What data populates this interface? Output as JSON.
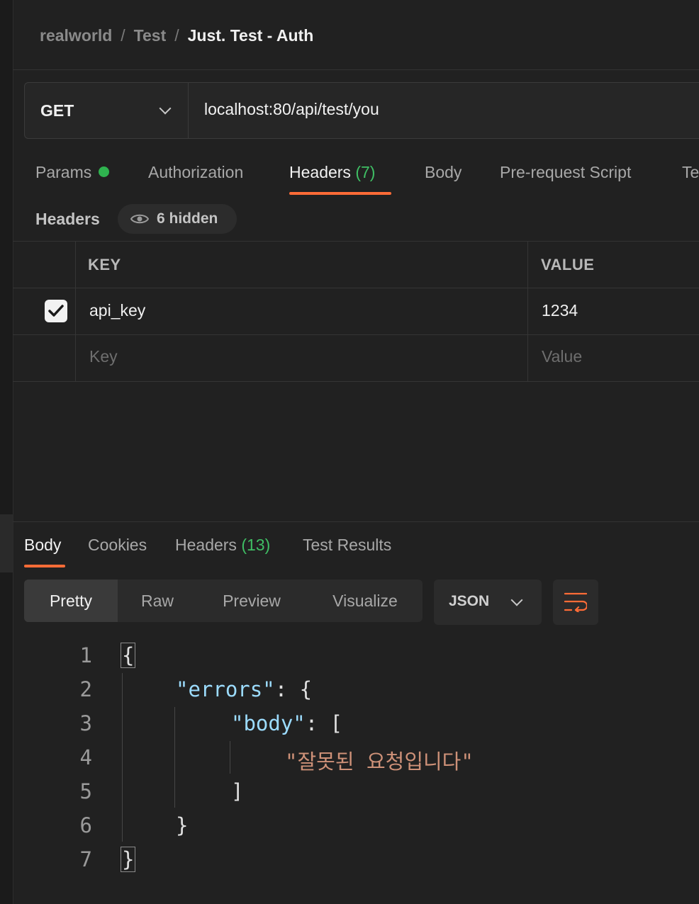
{
  "breadcrumb": {
    "workspace": "realworld",
    "collection": "Test",
    "request": "Just. Test - Auth",
    "separator": "/"
  },
  "request": {
    "method": "GET",
    "url": "localhost:80/api/test/you"
  },
  "request_tabs": {
    "params": "Params",
    "authorization": "Authorization",
    "headers": "Headers",
    "headers_count": "(7)",
    "body": "Body",
    "pre_request": "Pre-request Script",
    "tests_partial": "Te"
  },
  "headers_section": {
    "title": "Headers",
    "hidden_label": "6 hidden"
  },
  "headers_table": {
    "columns": {
      "key": "KEY",
      "value": "VALUE"
    },
    "rows": [
      {
        "key": "api_key",
        "value": "1234",
        "enabled": true
      }
    ],
    "placeholder": {
      "key": "Key",
      "value": "Value"
    }
  },
  "response_tabs": {
    "body": "Body",
    "cookies": "Cookies",
    "headers": "Headers",
    "headers_count": "(13)",
    "test_results": "Test Results"
  },
  "view_modes": [
    "Pretty",
    "Raw",
    "Preview",
    "Visualize"
  ],
  "format": "JSON",
  "code": {
    "line_numbers": [
      "1",
      "2",
      "3",
      "4",
      "5",
      "6",
      "7"
    ],
    "lines": {
      "l1": "{",
      "l2_key": "\"errors\"",
      "l2_rest": ": {",
      "l3_key": "\"body\"",
      "l3_rest": ": [",
      "l4_str": "\"잘못된 요청입니다\"",
      "l5": "]",
      "l6": "}",
      "l7": "}"
    }
  },
  "colors": {
    "accent": "#ff6c37",
    "green": "#3fbf64",
    "json_key": "#9cdcfe",
    "json_string": "#ce9178"
  }
}
